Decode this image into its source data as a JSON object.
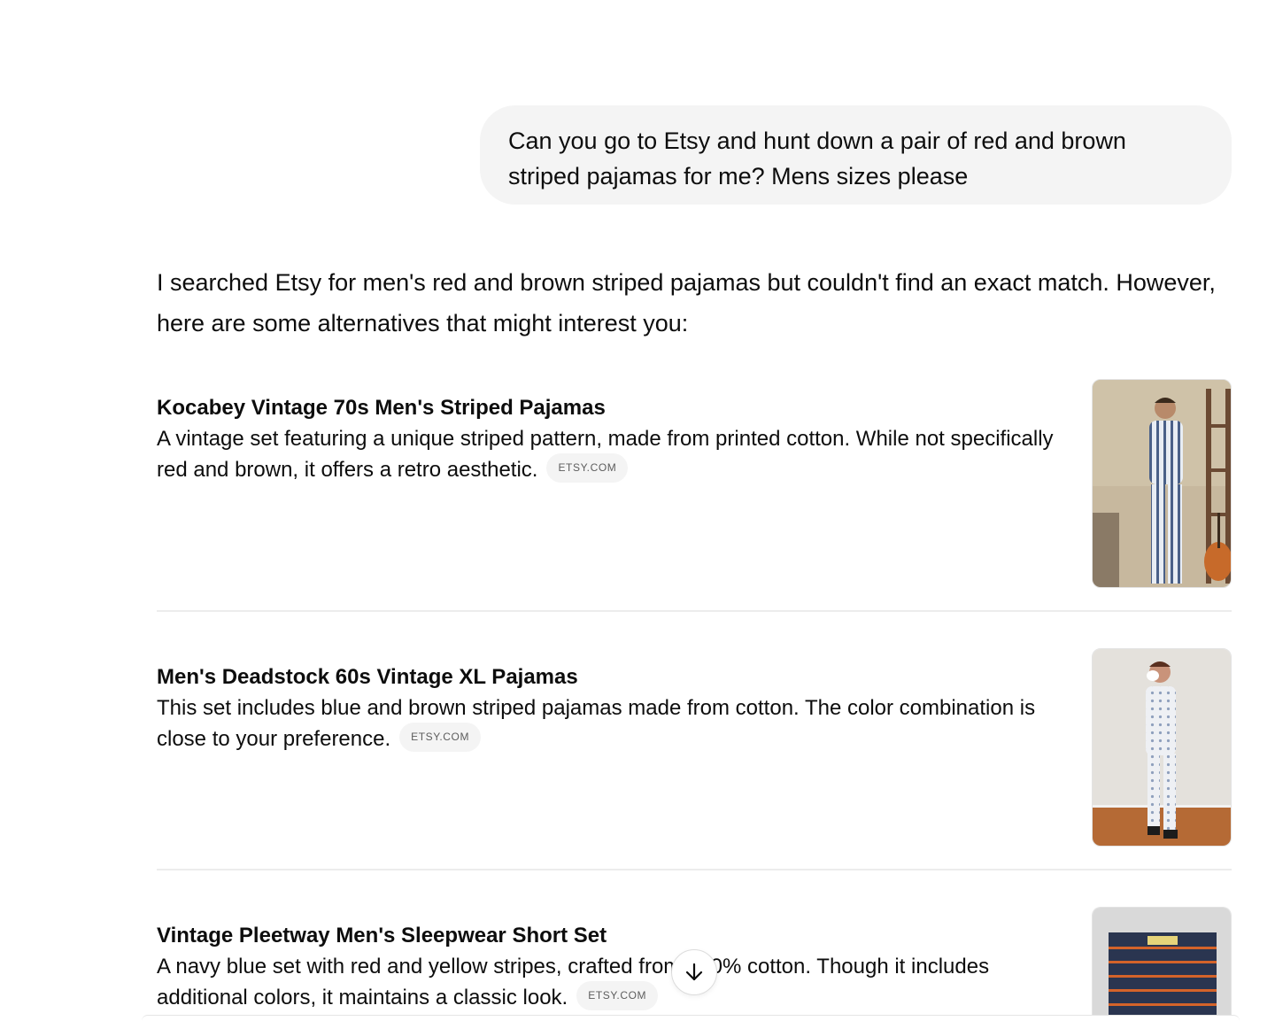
{
  "conversation": {
    "user_message": "Can you go to Etsy and hunt down a pair of red and brown striped pajamas for me? Mens sizes please",
    "assistant_intro": "I searched Etsy for men's red and brown striped pajamas but couldn't find an exact match. However, here are some alternatives that might interest you:"
  },
  "results": [
    {
      "title": "Kocabey Vintage 70s Men's Striped Pajamas",
      "description": "A vintage set featuring a unique striped pattern, made from printed cotton. While not specifically red and brown, it offers a retro aesthetic.",
      "source": "ETSY.COM",
      "image_icon": "striped-pajamas-photo"
    },
    {
      "title": "Men's Deadstock 60s Vintage XL Pajamas",
      "description": "This set includes blue and brown striped pajamas made from cotton. The color combination is close to your preference.",
      "source": "ETSY.COM",
      "image_icon": "patterned-pajamas-photo"
    },
    {
      "title": "Vintage Pleetway Men's Sleepwear Short Set",
      "description": "A navy blue set with red and yellow stripes, crafted from 100% cotton. Though it includes additional colors, it maintains a classic look.",
      "source": "ETSY.COM",
      "image_icon": "packaged-sleepwear-photo"
    }
  ],
  "controls": {
    "scroll_down_icon": "arrow-down-icon"
  },
  "colors": {
    "bubble_bg": "#f4f4f4",
    "text": "#0d0d0d",
    "chip_text": "#5d5d5d",
    "divider": "#ececec"
  }
}
